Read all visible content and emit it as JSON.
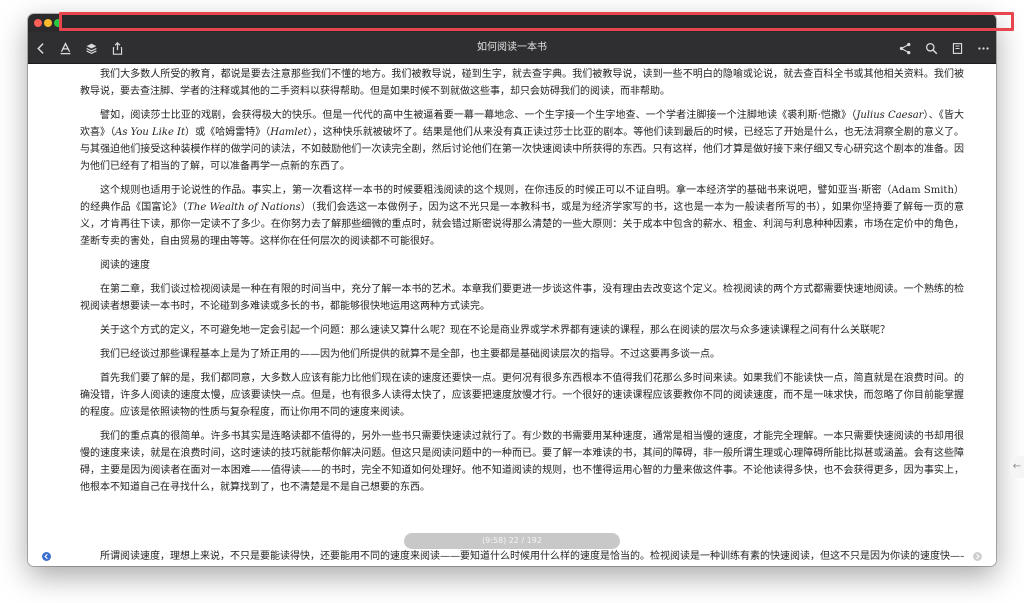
{
  "window": {
    "book_title": "如何阅读一本书",
    "colors": {
      "titlebar": "#2b2b2d",
      "toolbar": "#2f2f31",
      "highlight": "#e8464f",
      "nav_active": "#3b6fd0"
    }
  },
  "toolbar": {
    "left_icons": [
      "back-icon",
      "font-icon",
      "layers-icon",
      "share-icon"
    ],
    "right_icons": [
      "connect-icon",
      "search-icon",
      "bookmark-icon",
      "more-icon"
    ]
  },
  "content": {
    "p1": "我们大多数人所受的教育，都说是要去注意那些我们不懂的地方。我们被教导说，碰到生字，就去查字典。我们被教导说，读到一些不明白的隐喻或论说，就去查百科全书或其他相关资料。我们被教导说，要去查注脚、学者的注释或其他的二手资料以获得帮助。但是如果时候不到就做这些事，却只会妨碍我们的阅读，而非帮助。",
    "p2_a": "譬如，阅读莎士比亚的戏剧，会获得极大的快乐。但是一代代的高中生被逼着要一幕一幕地念、一个生字接一个生字地查、一个学者注脚接一个注脚地读《裘利斯·恺撒》（",
    "p2_julius": "Julius Caesar",
    "p2_b": "）、《皆大欢喜》（",
    "p2_asyou": "As You Like It",
    "p2_c": "）或《哈姆雷特》（",
    "p2_hamlet": "Hamlet",
    "p2_d": "），这种快乐就被破坏了。结果是他们从来没有真正读过莎士比亚的剧本。等他们读到最后的时候，已经忘了开始是什么，也无法洞察全剧的意义了。与其强迫他们接受这种装模作样的做学问的读法，不如鼓励他们一次读完全剧，然后讨论他们在第一次快速阅读中所获得的东西。只有这样，他们才算是做好接下来仔细又专心研究这个剧本的准备。因为他们已经有了相当的了解，可以准备再学一点新的东西了。",
    "p3_a": "这个规则也适用于论说性的作品。事实上，第一次看这样一本书的时候要粗浅阅读的这个规则，在你违反的时候正可以不证自明。拿一本经济学的基础书来说吧，譬如亚当·斯密（Adam Smith）的经典作品《国富论》（",
    "p3_wealth": "The Wealth of Nations",
    "p3_b": "）（我们会选这一本做例子，因为这不光只是一本教科书，或是为经济学家写的书，这也是一本为一般读者所写的书），如果你坚持要了解每一页的意义，才肯再往下读，那你一定读不了多少。在你努力去了解那些细微的重点时，就会错过斯密说得那么清楚的一些大原则：关于成本中包含的薪水、租金、利润与利息种种因素，市场在定价中的角色，垄断专卖的害处，自由贸易的理由等等。这样你在任何层次的阅读都不可能很好。",
    "heading": "阅读的速度",
    "p4": "在第二章，我们谈过检视阅读是一种在有限的时间当中，充分了解一本书的艺术。本章我们要更进一步谈这件事，没有理由去改变这个定义。检视阅读的两个方式都需要快速地阅读。一个熟练的检视阅读者想要读一本书时，不论碰到多难读或多长的书，都能够很快地运用这两种方式读完。",
    "p5": "关于这个方式的定义，不可避免地一定会引起一个问题：那么速读又算什么呢？现在不论是商业界或学术界都有速读的课程，那么在阅读的层次与众多速读课程之间有什么关联呢？",
    "p6": "我们已经谈过那些课程基本上是为了矫正用的——因为他们所提供的就算不是全部，也主要都是基础阅读层次的指导。不过这要再多谈一点。",
    "p7": "首先我们要了解的是，我们都同意，大多数人应该有能力比他们现在读的速度还要快一点。更何况有很多东西根本不值得我们花那么多时间来读。如果我们不能读快一点，简直就是在浪费时间。的确没错，许多人阅读的速度太慢，应该要读快一点。但是，也有很多人读得太快了，应该要把速度放慢才行。一个很好的速读课程应该要教你不同的阅读速度，而不是一味求快，而忽略了你目前能掌握的程度。应该是依照读物的性质与复杂程度，而让你用不同的速度来阅读。",
    "p8": "我们的重点真的很简单。许多书其实是连略读都不值得的，另外一些书只需要快速读过就行了。有少数的书需要用某种速度，通常是相当慢的速度，才能完全理解。一本只需要快速阅读的书却用很慢的速度来读，就是在浪费时间，这时速读的技巧就能帮你解决问题。但这只是阅读问题中的一种而已。要了解一本难读的书，其间的障碍，非一般所谓生理或心理障碍所能比拟甚或涵盖。会有这些障碍，主要是因为阅读者在面对一本困难——值得读——的书时，完全不知道如何处理好。他不知道阅读的规则，也不懂得运用心智的力量来做这件事。不论他读得多快，也不会获得更多，因为事实上，他根本不知道自己在寻找什么，就算找到了，也不清楚是不是自己想要的东西。",
    "p9": "所谓阅读速度，理想上来说，不只是要能读得快，还要能用不同的速度来阅读——要知道什么时候用什么样的速度是恰当的。检视阅读是一种训练有素的快速阅读，但这不只是因为你读的速度快——虽然",
    "page_indicator": "(9:58) 22 / 192"
  }
}
